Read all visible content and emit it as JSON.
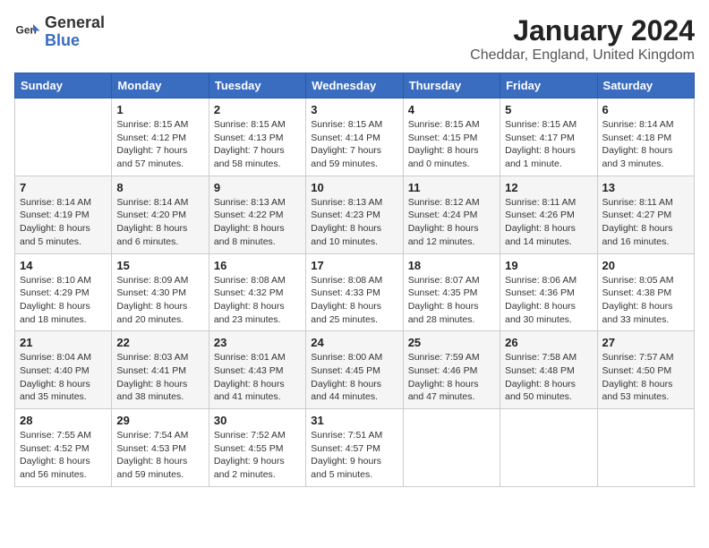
{
  "header": {
    "logo_general": "General",
    "logo_blue": "Blue",
    "title": "January 2024",
    "subtitle": "Cheddar, England, United Kingdom"
  },
  "days_of_week": [
    "Sunday",
    "Monday",
    "Tuesday",
    "Wednesday",
    "Thursday",
    "Friday",
    "Saturday"
  ],
  "weeks": [
    [
      {
        "day": "",
        "info": ""
      },
      {
        "day": "1",
        "info": "Sunrise: 8:15 AM\nSunset: 4:12 PM\nDaylight: 7 hours\nand 57 minutes."
      },
      {
        "day": "2",
        "info": "Sunrise: 8:15 AM\nSunset: 4:13 PM\nDaylight: 7 hours\nand 58 minutes."
      },
      {
        "day": "3",
        "info": "Sunrise: 8:15 AM\nSunset: 4:14 PM\nDaylight: 7 hours\nand 59 minutes."
      },
      {
        "day": "4",
        "info": "Sunrise: 8:15 AM\nSunset: 4:15 PM\nDaylight: 8 hours\nand 0 minutes."
      },
      {
        "day": "5",
        "info": "Sunrise: 8:15 AM\nSunset: 4:17 PM\nDaylight: 8 hours\nand 1 minute."
      },
      {
        "day": "6",
        "info": "Sunrise: 8:14 AM\nSunset: 4:18 PM\nDaylight: 8 hours\nand 3 minutes."
      }
    ],
    [
      {
        "day": "7",
        "info": "Sunrise: 8:14 AM\nSunset: 4:19 PM\nDaylight: 8 hours\nand 5 minutes."
      },
      {
        "day": "8",
        "info": "Sunrise: 8:14 AM\nSunset: 4:20 PM\nDaylight: 8 hours\nand 6 minutes."
      },
      {
        "day": "9",
        "info": "Sunrise: 8:13 AM\nSunset: 4:22 PM\nDaylight: 8 hours\nand 8 minutes."
      },
      {
        "day": "10",
        "info": "Sunrise: 8:13 AM\nSunset: 4:23 PM\nDaylight: 8 hours\nand 10 minutes."
      },
      {
        "day": "11",
        "info": "Sunrise: 8:12 AM\nSunset: 4:24 PM\nDaylight: 8 hours\nand 12 minutes."
      },
      {
        "day": "12",
        "info": "Sunrise: 8:11 AM\nSunset: 4:26 PM\nDaylight: 8 hours\nand 14 minutes."
      },
      {
        "day": "13",
        "info": "Sunrise: 8:11 AM\nSunset: 4:27 PM\nDaylight: 8 hours\nand 16 minutes."
      }
    ],
    [
      {
        "day": "14",
        "info": "Sunrise: 8:10 AM\nSunset: 4:29 PM\nDaylight: 8 hours\nand 18 minutes."
      },
      {
        "day": "15",
        "info": "Sunrise: 8:09 AM\nSunset: 4:30 PM\nDaylight: 8 hours\nand 20 minutes."
      },
      {
        "day": "16",
        "info": "Sunrise: 8:08 AM\nSunset: 4:32 PM\nDaylight: 8 hours\nand 23 minutes."
      },
      {
        "day": "17",
        "info": "Sunrise: 8:08 AM\nSunset: 4:33 PM\nDaylight: 8 hours\nand 25 minutes."
      },
      {
        "day": "18",
        "info": "Sunrise: 8:07 AM\nSunset: 4:35 PM\nDaylight: 8 hours\nand 28 minutes."
      },
      {
        "day": "19",
        "info": "Sunrise: 8:06 AM\nSunset: 4:36 PM\nDaylight: 8 hours\nand 30 minutes."
      },
      {
        "day": "20",
        "info": "Sunrise: 8:05 AM\nSunset: 4:38 PM\nDaylight: 8 hours\nand 33 minutes."
      }
    ],
    [
      {
        "day": "21",
        "info": "Sunrise: 8:04 AM\nSunset: 4:40 PM\nDaylight: 8 hours\nand 35 minutes."
      },
      {
        "day": "22",
        "info": "Sunrise: 8:03 AM\nSunset: 4:41 PM\nDaylight: 8 hours\nand 38 minutes."
      },
      {
        "day": "23",
        "info": "Sunrise: 8:01 AM\nSunset: 4:43 PM\nDaylight: 8 hours\nand 41 minutes."
      },
      {
        "day": "24",
        "info": "Sunrise: 8:00 AM\nSunset: 4:45 PM\nDaylight: 8 hours\nand 44 minutes."
      },
      {
        "day": "25",
        "info": "Sunrise: 7:59 AM\nSunset: 4:46 PM\nDaylight: 8 hours\nand 47 minutes."
      },
      {
        "day": "26",
        "info": "Sunrise: 7:58 AM\nSunset: 4:48 PM\nDaylight: 8 hours\nand 50 minutes."
      },
      {
        "day": "27",
        "info": "Sunrise: 7:57 AM\nSunset: 4:50 PM\nDaylight: 8 hours\nand 53 minutes."
      }
    ],
    [
      {
        "day": "28",
        "info": "Sunrise: 7:55 AM\nSunset: 4:52 PM\nDaylight: 8 hours\nand 56 minutes."
      },
      {
        "day": "29",
        "info": "Sunrise: 7:54 AM\nSunset: 4:53 PM\nDaylight: 8 hours\nand 59 minutes."
      },
      {
        "day": "30",
        "info": "Sunrise: 7:52 AM\nSunset: 4:55 PM\nDaylight: 9 hours\nand 2 minutes."
      },
      {
        "day": "31",
        "info": "Sunrise: 7:51 AM\nSunset: 4:57 PM\nDaylight: 9 hours\nand 5 minutes."
      },
      {
        "day": "",
        "info": ""
      },
      {
        "day": "",
        "info": ""
      },
      {
        "day": "",
        "info": ""
      }
    ]
  ]
}
